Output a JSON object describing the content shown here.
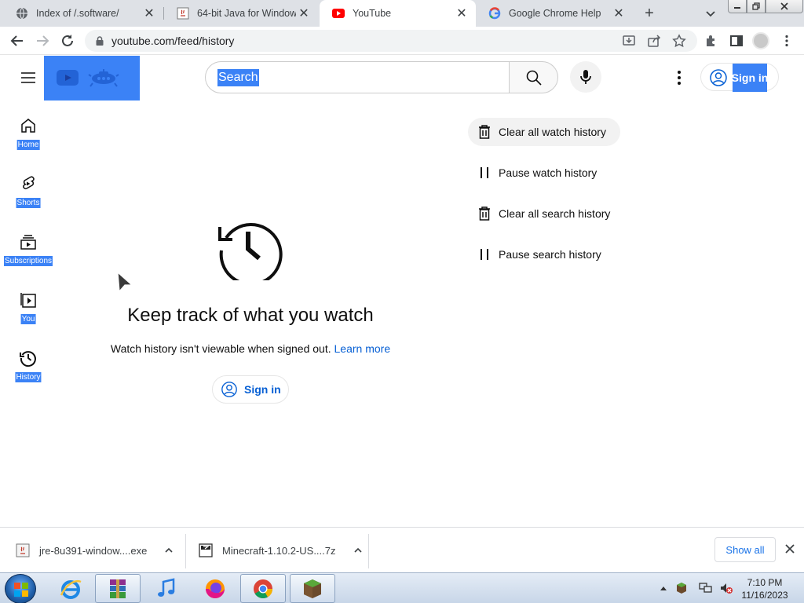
{
  "browser": {
    "tabs": [
      {
        "title": "Index of /.software/",
        "favicon": "globe-icon",
        "active": false
      },
      {
        "title": "64-bit Java for Windows",
        "favicon": "java-icon",
        "active": false
      },
      {
        "title": "YouTube",
        "favicon": "youtube-icon",
        "active": true
      },
      {
        "title": "Google Chrome Help",
        "favicon": "google-icon",
        "active": false
      }
    ],
    "url": "youtube.com/feed/history"
  },
  "yt": {
    "search_placeholder": "Search",
    "signin_label": "Sign in",
    "sidebar": [
      {
        "label": "Home",
        "icon": "home-icon"
      },
      {
        "label": "Shorts",
        "icon": "shorts-icon"
      },
      {
        "label": "Subscriptions",
        "icon": "subscriptions-icon"
      },
      {
        "label": "You",
        "icon": "you-icon"
      },
      {
        "label": "History",
        "icon": "history-icon"
      }
    ],
    "empty_state": {
      "headline": "Keep track of what you watch",
      "subtext": "Watch history isn't viewable when signed out.",
      "link": "Learn more",
      "button": "Sign in"
    },
    "actions": [
      {
        "label": "Clear all watch history",
        "icon": "trash-icon"
      },
      {
        "label": "Pause watch history",
        "icon": "pause-icon"
      },
      {
        "label": "Clear all search history",
        "icon": "trash-icon"
      },
      {
        "label": "Pause search history",
        "icon": "pause-icon"
      }
    ]
  },
  "downloads": {
    "items": [
      {
        "name": "jre-8u391-window....exe"
      },
      {
        "name": "Minecraft-1.10.2-US....7z"
      }
    ],
    "show_all": "Show all"
  },
  "taskbar": {
    "time": "7:10 PM",
    "date": "11/16/2023"
  },
  "colors": {
    "selection": "#3b82f6",
    "link": "#065fd4",
    "chrome_frame": "#dee1e6"
  }
}
